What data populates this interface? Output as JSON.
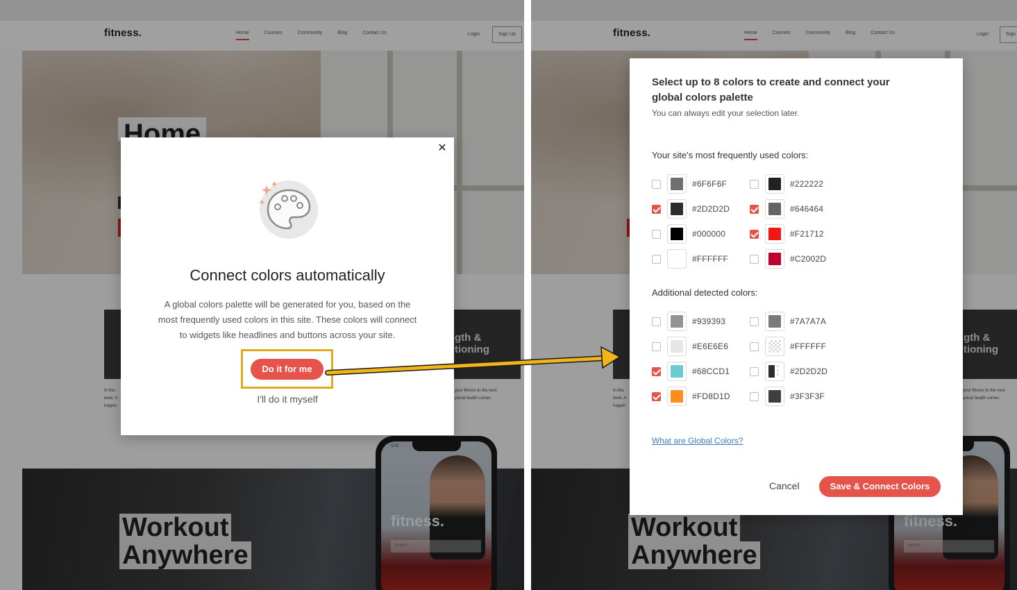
{
  "site": {
    "logo": "fitness.",
    "nav": [
      "Home",
      "Courses",
      "Community",
      "Blog",
      "Contact Us"
    ],
    "login": "Login",
    "signup": "Sign Up",
    "signup_cut": "Sign",
    "hero_title": "Home",
    "card_title_line1": "gth &",
    "card_title_line2": "tioning",
    "card_text_left_1": "In this",
    "card_text_left_2": "level. A",
    "card_text_left_3": "happin",
    "card_text_right_1": "your fitness to the next",
    "card_text_right_2": "ysical health comes",
    "workout_line1": "Workout",
    "workout_line2": "Anywhere",
    "phone_logo": "fitness.",
    "phone_search": "Search",
    "phone_time": "9:41"
  },
  "modal1": {
    "title": "Connect colors automatically",
    "description": "A global colors palette will be generated for you, based on the most frequently used colors in this site. These colors will connect to widgets like headlines and buttons across your site.",
    "primary_button": "Do it for me",
    "secondary_link": "I'll do it myself",
    "icon": "palette-icon",
    "close_icon": "close-icon",
    "close_glyph": "✕"
  },
  "modal2": {
    "title": "Select up to 8 colors to create and connect your global colors palette",
    "subtitle": "You can always edit your selection later.",
    "section_frequent": "Your site's most frequently used colors:",
    "section_additional": "Additional detected colors:",
    "frequent_colors": [
      {
        "hex": "#6F6F6F",
        "checked": false
      },
      {
        "hex": "#222222",
        "checked": false
      },
      {
        "hex": "#2D2D2D",
        "checked": true
      },
      {
        "hex": "#646464",
        "checked": true
      },
      {
        "hex": "#000000",
        "checked": false
      },
      {
        "hex": "#F21712",
        "checked": true
      },
      {
        "hex": "#FFFFFF",
        "checked": false
      },
      {
        "hex": "#C2002D",
        "checked": false
      }
    ],
    "additional_colors": [
      {
        "hex": "#939393",
        "checked": false
      },
      {
        "hex": "#7A7A7A",
        "checked": false
      },
      {
        "hex": "#E6E6E6",
        "checked": false
      },
      {
        "hex": "#FFFFFF",
        "checked": false,
        "transparent": true
      },
      {
        "hex": "#68CCD1",
        "checked": true
      },
      {
        "hex": "#2D2D2D",
        "checked": false,
        "transparent": true
      },
      {
        "hex": "#FD8D1D",
        "checked": true
      },
      {
        "hex": "#3F3F3F",
        "checked": false
      }
    ],
    "help_link": "What are Global Colors?",
    "cancel": "Cancel",
    "save": "Save & Connect Colors"
  },
  "colors": {
    "accent": "#e5534b",
    "highlight": "#e2a91c",
    "link": "#3b7bbf"
  }
}
